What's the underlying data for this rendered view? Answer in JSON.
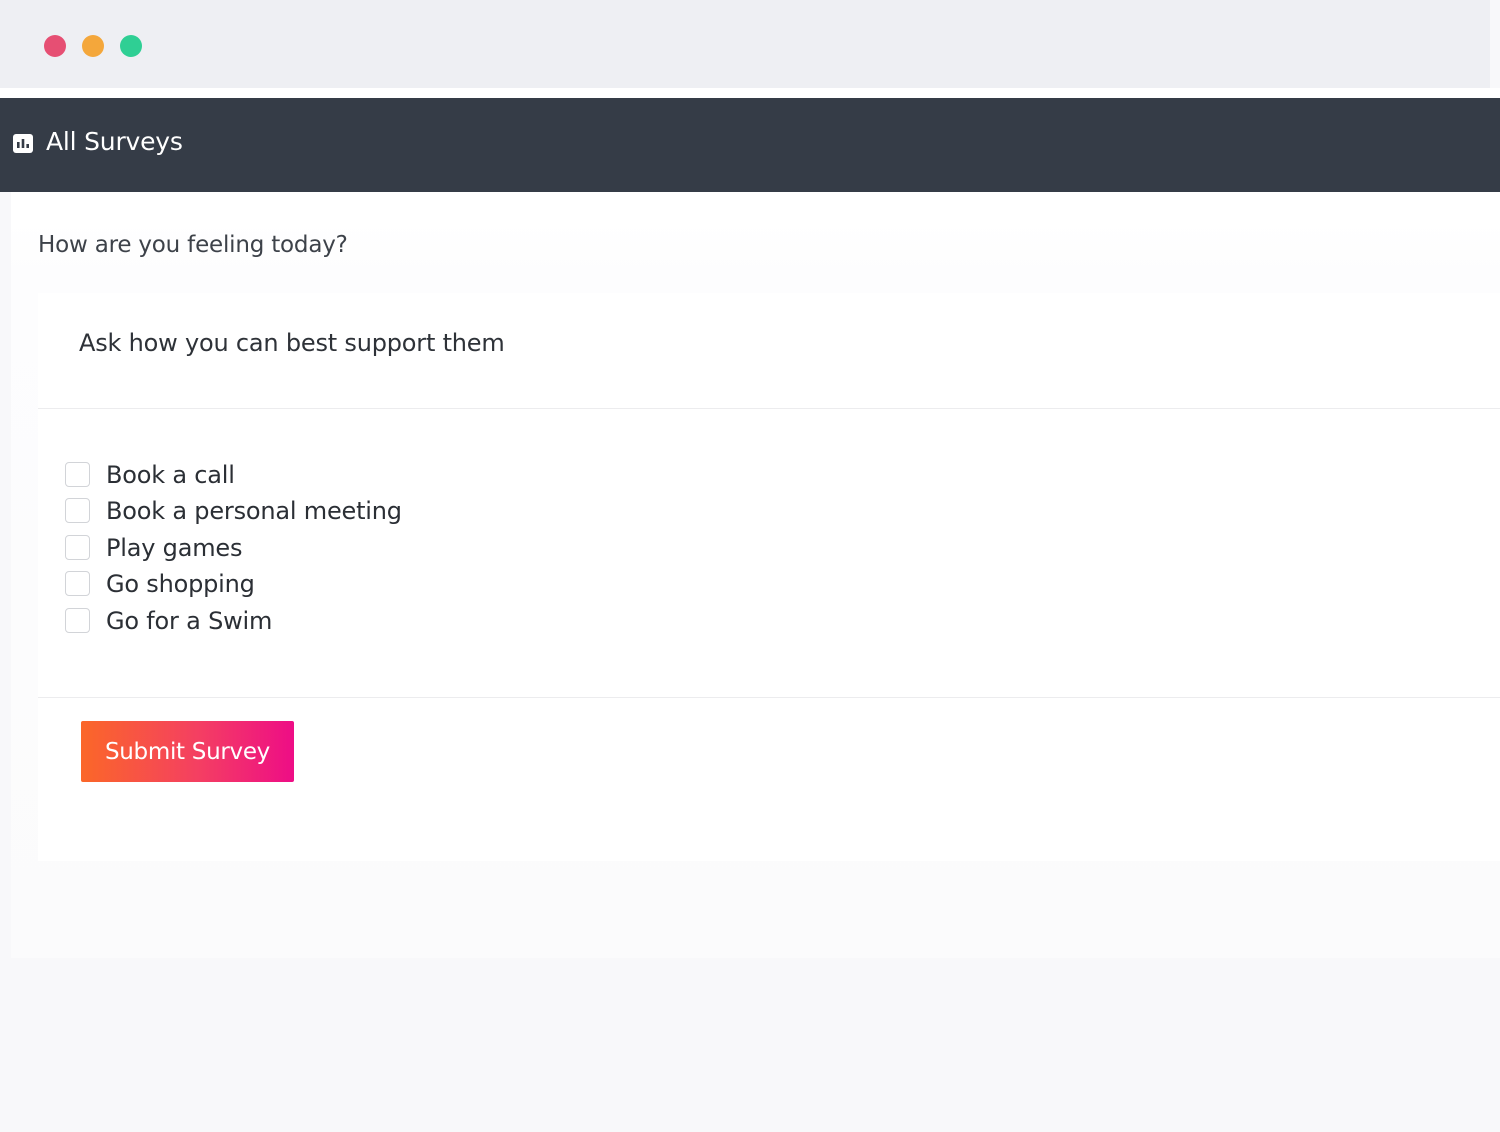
{
  "window": {
    "controls": [
      {
        "name": "close",
        "color": "#e64f73"
      },
      {
        "name": "minimize",
        "color": "#f4a73b"
      },
      {
        "name": "maximize",
        "color": "#2fcf94"
      }
    ]
  },
  "header": {
    "icon": "bar-chart-icon",
    "title": "All Surveys",
    "background": "#353c47"
  },
  "survey": {
    "question": "How are you feeling today?",
    "card_title": "Ask how you can best support them",
    "options": [
      {
        "label": "Book a call",
        "checked": false
      },
      {
        "label": "Book a personal meeting",
        "checked": false
      },
      {
        "label": "Play games",
        "checked": false
      },
      {
        "label": "Go shopping",
        "checked": false
      },
      {
        "label": "Go for a Swim",
        "checked": false
      }
    ],
    "submit_label": "Submit Survey",
    "submit_gradient": [
      "#fb6728",
      "#f43f62",
      "#ee0d86"
    ]
  }
}
